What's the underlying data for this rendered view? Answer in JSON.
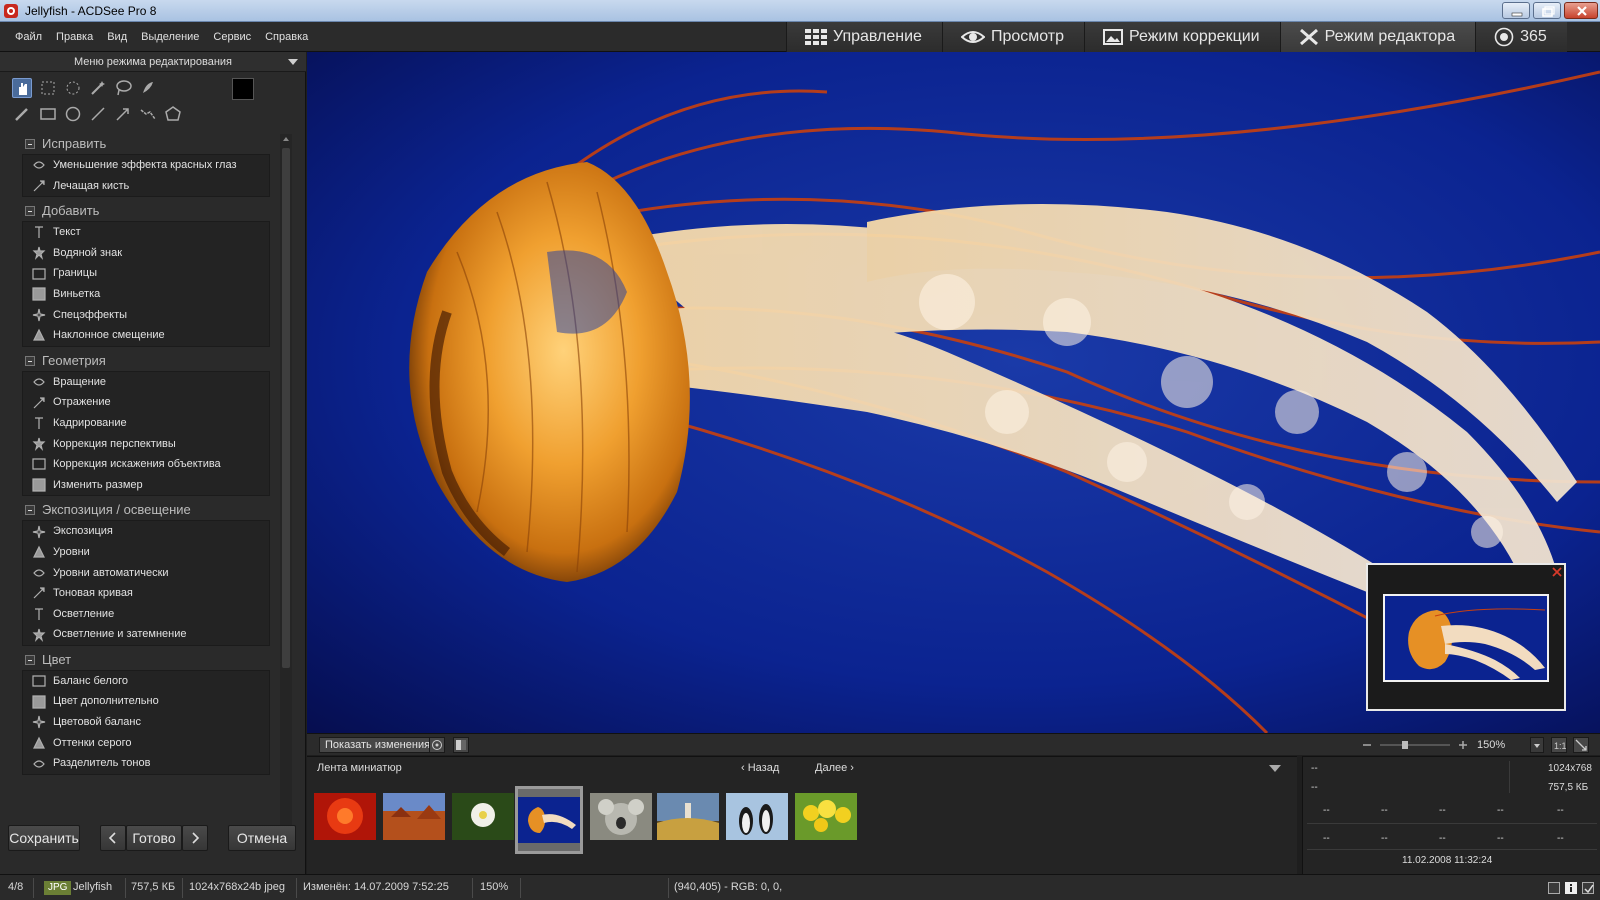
{
  "window": {
    "title": "Jellyfish - ACDSee Pro 8"
  },
  "menu": [
    "Файл",
    "Правка",
    "Вид",
    "Выделение",
    "Сервис",
    "Справка"
  ],
  "modes": {
    "manage": "Управление",
    "view": "Просмотр",
    "develop": "Режим коррекции",
    "edit": "Режим редактора",
    "online": "365",
    "active": "edit"
  },
  "left_panel": {
    "title": "Меню режима редактирования",
    "groups": [
      {
        "name": "Исправить",
        "items": [
          "Уменьшение эффекта красных глаз",
          "Лечащая кисть"
        ]
      },
      {
        "name": "Добавить",
        "items": [
          "Текст",
          "Водяной знак",
          "Границы",
          "Виньетка",
          "Спецэффекты",
          "Наклонное смещение"
        ]
      },
      {
        "name": "Геометрия",
        "items": [
          "Вращение",
          "Отражение",
          "Кадрирование",
          "Коррекция перспективы",
          "Коррекция искажения объектива",
          "Изменить размер"
        ]
      },
      {
        "name": "Экспозиция / освещение",
        "items": [
          "Экспозиция",
          "Уровни",
          "Уровни автоматически",
          "Тоновая кривая",
          "Осветление",
          "Осветление и затемнение"
        ]
      },
      {
        "name": "Цвет",
        "items": [
          "Баланс белого",
          "Цвет дополнительно",
          "Цветовой баланс",
          "Оттенки серого",
          "Разделитель тонов"
        ]
      }
    ],
    "buttons": {
      "save": "Сохранить",
      "done": "Готово",
      "cancel": "Отмена"
    }
  },
  "viewer": {
    "show_changes": "Показать изменения",
    "zoom": "150%"
  },
  "filmstrip": {
    "title": "Лента миниатюр",
    "prev": "Назад",
    "next": "Далее",
    "selected_index": 3
  },
  "info_panel": {
    "top_left_1": "--",
    "top_left_2": "--",
    "dimensions": "1024x768",
    "size": "757,5 КБ",
    "row1": [
      "--",
      "--",
      "--",
      "--",
      "--"
    ],
    "row2": [
      "--",
      "--",
      "--",
      "--",
      "--"
    ],
    "date": "11.02.2008 11:32:24"
  },
  "status": {
    "position": "4/8",
    "format": "JPG",
    "filename": "Jellyfish",
    "filesize": "757,5 КБ",
    "dims": "1024x768x24b jpeg",
    "modified": "Изменён: 14.07.2009 7:52:25",
    "zoom": "150%",
    "pixel": "(940,405) - RGB: 0, 0,"
  },
  "colors": {
    "accent": "#4a6b9a",
    "ocean": "#0a1a72",
    "jelly_orange": "#e08a1a",
    "tentacle_red": "#c83a10"
  }
}
